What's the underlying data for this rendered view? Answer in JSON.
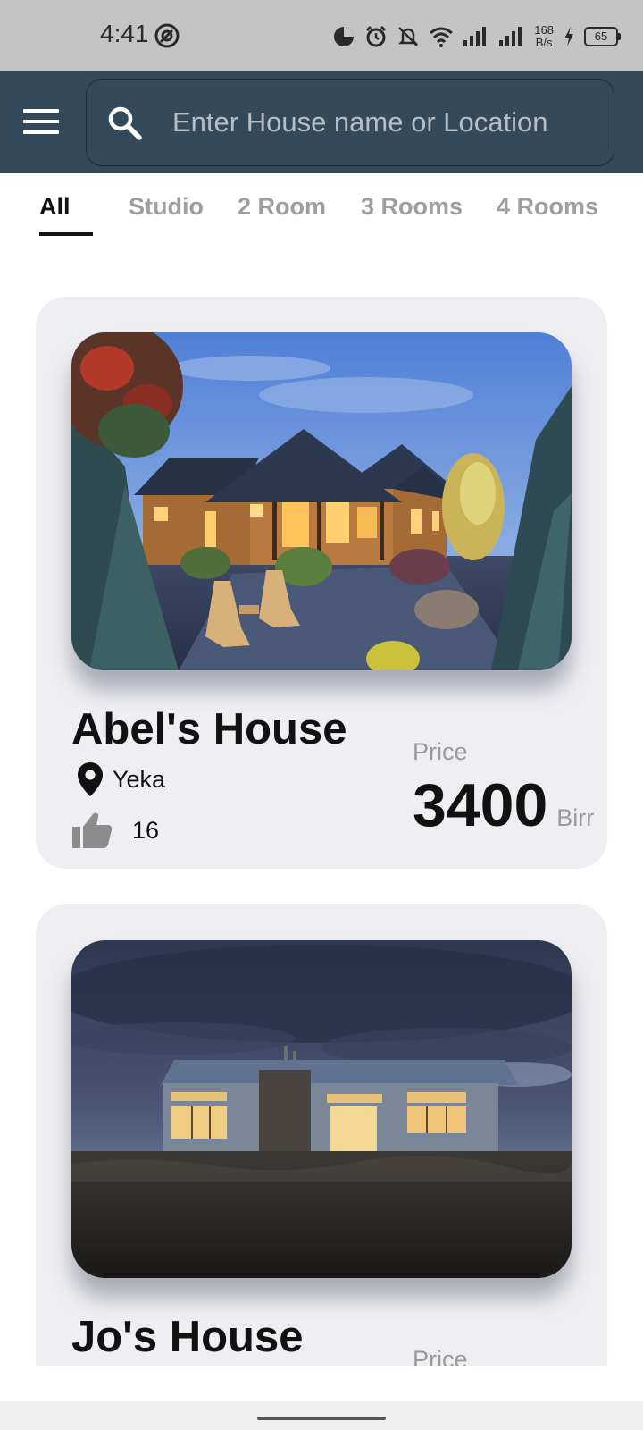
{
  "status_bar": {
    "time": "4:41",
    "net_speed_value": "168",
    "net_speed_unit": "B/s",
    "battery": "65"
  },
  "app_bar": {
    "search_placeholder": "Enter House name or Location"
  },
  "tabs": [
    {
      "label": "All",
      "active": true
    },
    {
      "label": "Studio",
      "active": false
    },
    {
      "label": "2 Room",
      "active": false
    },
    {
      "label": "3 Rooms",
      "active": false
    },
    {
      "label": "4 Rooms",
      "active": false
    }
  ],
  "listings": [
    {
      "name": "Abel's House",
      "location": "Yeka",
      "likes": "16",
      "price_label": "Price",
      "price": "3400",
      "currency": "Birr"
    },
    {
      "name": "Jo's House",
      "price_label": "Price"
    }
  ],
  "colors": {
    "app_bar": "#34495a",
    "status_bar": "#c4c4c4",
    "card_bg": "#efeff3",
    "active_tab": "#111111",
    "inactive_tab": "#9e9e9e"
  }
}
